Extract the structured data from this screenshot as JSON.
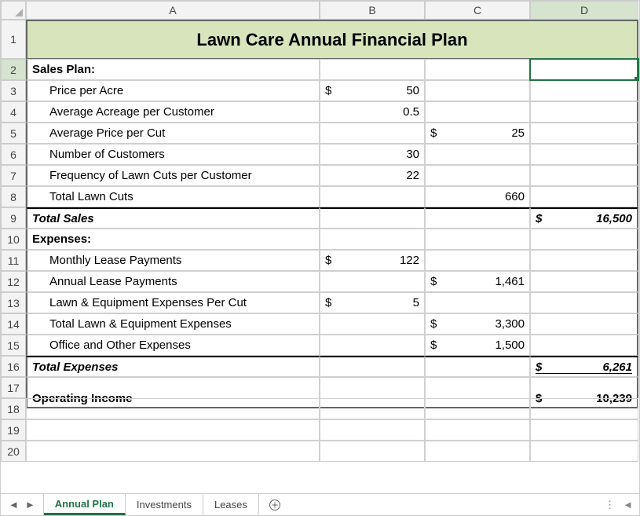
{
  "columns": [
    "A",
    "B",
    "C",
    "D"
  ],
  "row_numbers": [
    "1",
    "2",
    "3",
    "4",
    "5",
    "6",
    "7",
    "8",
    "9",
    "10",
    "11",
    "12",
    "13",
    "14",
    "15",
    "16",
    "17",
    "18",
    "19",
    "20"
  ],
  "title": "Lawn Care Annual Financial Plan",
  "sections": {
    "sales_plan_label": "Sales Plan:",
    "price_per_acre": "Price per Acre",
    "avg_acreage": "Average Acreage per Customer",
    "avg_price_cut": "Average Price per Cut",
    "num_customers": "Number of Customers",
    "freq_cuts": "Frequency of Lawn Cuts per Customer",
    "total_cuts": "Total Lawn Cuts",
    "total_sales": "Total Sales",
    "expenses_label": "Expenses:",
    "monthly_lease": "Monthly Lease Payments",
    "annual_lease": "Annual Lease Payments",
    "equip_per_cut": "Lawn & Equipment Expenses Per Cut",
    "total_equip": "Total Lawn & Equipment Expenses",
    "office_other": "Office and Other Expenses",
    "total_expenses": "Total Expenses",
    "operating_income": "Operating Income"
  },
  "values": {
    "b3_sym": "$",
    "b3": "50",
    "b4": "0.5",
    "c5_sym": "$",
    "c5": "25",
    "b6": "30",
    "b7": "22",
    "c8": "660",
    "d9_sym": "$",
    "d9": "16,500",
    "b11_sym": "$",
    "b11": "122",
    "c12_sym": "$",
    "c12": "1,461",
    "b13_sym": "$",
    "b13": "5",
    "c14_sym": "$",
    "c14": "3,300",
    "c15_sym": "$",
    "c15": "1,500",
    "d16_sym": "$",
    "d16": "6,261",
    "d17_sym": "$",
    "d17": "10,239"
  },
  "tabs": {
    "t1": "Annual Plan",
    "t2": "Investments",
    "t3": "Leases"
  },
  "chart_data": {
    "type": "table",
    "title": "Lawn Care Annual Financial Plan",
    "rows": [
      {
        "label": "Price per Acre",
        "b": 50
      },
      {
        "label": "Average Acreage per Customer",
        "b": 0.5
      },
      {
        "label": "Average Price per Cut",
        "c": 25
      },
      {
        "label": "Number of Customers",
        "b": 30
      },
      {
        "label": "Frequency of Lawn Cuts per Customer",
        "b": 22
      },
      {
        "label": "Total Lawn Cuts",
        "c": 660
      },
      {
        "label": "Total Sales",
        "d": 16500
      },
      {
        "label": "Monthly Lease Payments",
        "b": 122
      },
      {
        "label": "Annual Lease Payments",
        "c": 1461
      },
      {
        "label": "Lawn & Equipment Expenses Per Cut",
        "b": 5
      },
      {
        "label": "Total Lawn & Equipment Expenses",
        "c": 3300
      },
      {
        "label": "Office and Other Expenses",
        "c": 1500
      },
      {
        "label": "Total Expenses",
        "d": 6261
      },
      {
        "label": "Operating Income",
        "d": 10239
      }
    ]
  }
}
